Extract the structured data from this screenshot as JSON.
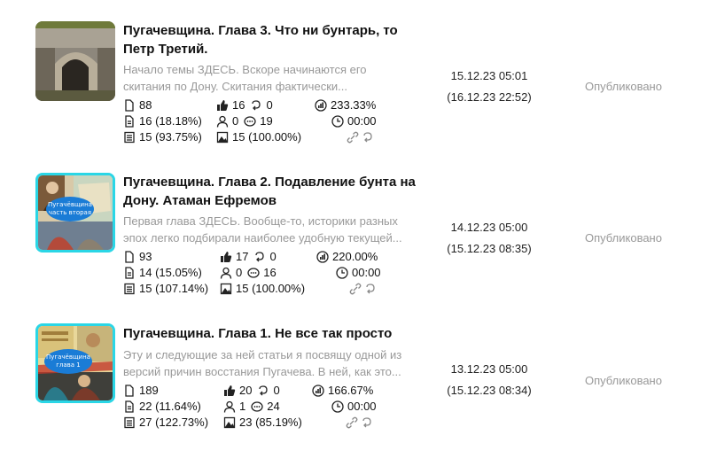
{
  "articles": [
    {
      "title": "Пугачевщина. Глава 3. Что ни бунтарь, то Петр Третий.",
      "excerpt": "Начало темы ЗДЕСЬ. Вскоре начинаются его скитания по Дону. Скитания фактически...",
      "views": "88",
      "reads": "16 (18.18%)",
      "full_reads": "15 (93.75%)",
      "likes": "16",
      "reposts": "0",
      "subscribers": "0",
      "comments": "19",
      "images": "15 (100.00%)",
      "ctr": "233.33%",
      "read_time": "00:00",
      "date_published": "15.12.23 05:01",
      "date_updated": "(16.12.23 22:52)",
      "status": "Опубликовано"
    },
    {
      "title": "Пугачевщина. Глава 2. Подавление бунта на Дону. Атаман Ефремов",
      "excerpt": "Первая глава ЗДЕСЬ. Вообще-то, историки разных эпох легко подбирали наиболее удобную текущей...",
      "views": "93",
      "reads": "14 (15.05%)",
      "full_reads": "15 (107.14%)",
      "likes": "17",
      "reposts": "0",
      "subscribers": "0",
      "comments": "16",
      "images": "15 (100.00%)",
      "ctr": "220.00%",
      "read_time": "00:00",
      "date_published": "14.12.23 05:00",
      "date_updated": "(15.12.23 08:35)",
      "status": "Опубликовано",
      "thumb_caption": [
        "Пугачёвщина",
        "часть вторая"
      ]
    },
    {
      "title": "Пугачевщина. Глава 1. Не все так просто",
      "excerpt": "Эту и следующие за ней статьи я посвящу одной из версий причин восстания Пугачева. В ней, как это...",
      "views": "189",
      "reads": "22 (11.64%)",
      "full_reads": "27 (122.73%)",
      "likes": "20",
      "reposts": "0",
      "subscribers": "1",
      "comments": "24",
      "images": "23 (85.19%)",
      "ctr": "166.67%",
      "read_time": "00:00",
      "date_published": "13.12.23 05:00",
      "date_updated": "(15.12.23 08:34)",
      "status": "Опубликовано",
      "thumb_caption": [
        "Пугачёвщина",
        "глава 1"
      ]
    }
  ],
  "icons": {
    "views": "document-icon",
    "reads": "document-lines-icon",
    "full_reads": "document-list-icon",
    "likes": "thumbs-up-icon",
    "reposts": "repost-icon",
    "subscribers": "person-icon",
    "comments": "comment-icon",
    "images": "image-icon",
    "ctr": "ctr-badge-icon",
    "read_time": "clock-icon",
    "links": "link-icon"
  },
  "colors": {
    "highlight_border": "#2ad6e6",
    "muted_text": "#999999"
  }
}
